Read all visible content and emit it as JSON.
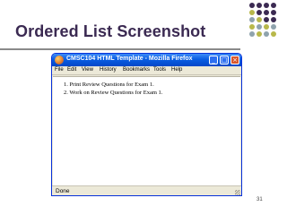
{
  "slide": {
    "title": "Ordered List Screenshot",
    "page_number": "31",
    "colors": {
      "title": "#3b2a52",
      "dot_dark": "#3b2a52",
      "dot_olive": "#b8b84a",
      "dot_gray": "#8fa3ad"
    }
  },
  "window": {
    "title": "CMSC104 HTML Template - Mozilla Firefox",
    "app_icon": "firefox-icon",
    "controls": [
      "minimize-icon",
      "maximize-icon",
      "close-icon"
    ],
    "menu": [
      "File",
      "Edit",
      "View",
      "History",
      "Bookmarks",
      "Tools",
      "Help"
    ],
    "list": [
      "1.  Print Review Questions for Exam 1.",
      "2.  Work on Review Questions for Exam 1."
    ],
    "status": "Done"
  }
}
